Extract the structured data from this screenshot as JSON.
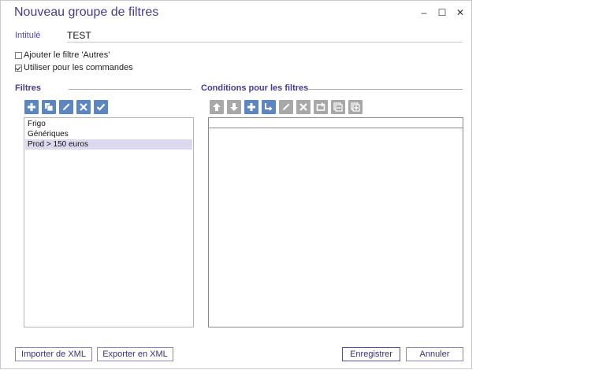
{
  "window": {
    "title": "Nouveau groupe de filtres",
    "minimize": "–",
    "maximize": "☐",
    "close": "✕"
  },
  "intitule": {
    "label": "Intitulé",
    "value": "TEST"
  },
  "options": {
    "autres": {
      "label": "Ajouter le filtre 'Autres'",
      "checked": false
    },
    "commandes": {
      "label": "Utiliser pour les commandes",
      "checked": true
    }
  },
  "filtres": {
    "title": "Filtres",
    "toolbar": [
      "add-icon",
      "duplicate-icon",
      "edit-icon",
      "delete-icon",
      "validate-icon"
    ],
    "items": [
      {
        "label": "Frigo",
        "selected": false
      },
      {
        "label": "Génériques",
        "selected": false
      },
      {
        "label": "Prod > 150 euros",
        "selected": true
      }
    ]
  },
  "conditions": {
    "title": "Conditions pour les filtres",
    "toolbar": [
      "move-up-icon",
      "move-down-icon",
      "add-icon",
      "indent-icon",
      "edit-icon",
      "delete-icon",
      "replace-icon",
      "collapse-icon",
      "expand-icon"
    ]
  },
  "footer": {
    "import": "Importer de XML",
    "export": "Exporter en XML",
    "save": "Enregistrer",
    "cancel": "Annuler"
  },
  "colors": {
    "accent": "#4b3a8f",
    "toolbar_blue": "#5b86c1",
    "toolbar_disabled": "#a8a8a8",
    "selection": "#dcd8ee"
  }
}
